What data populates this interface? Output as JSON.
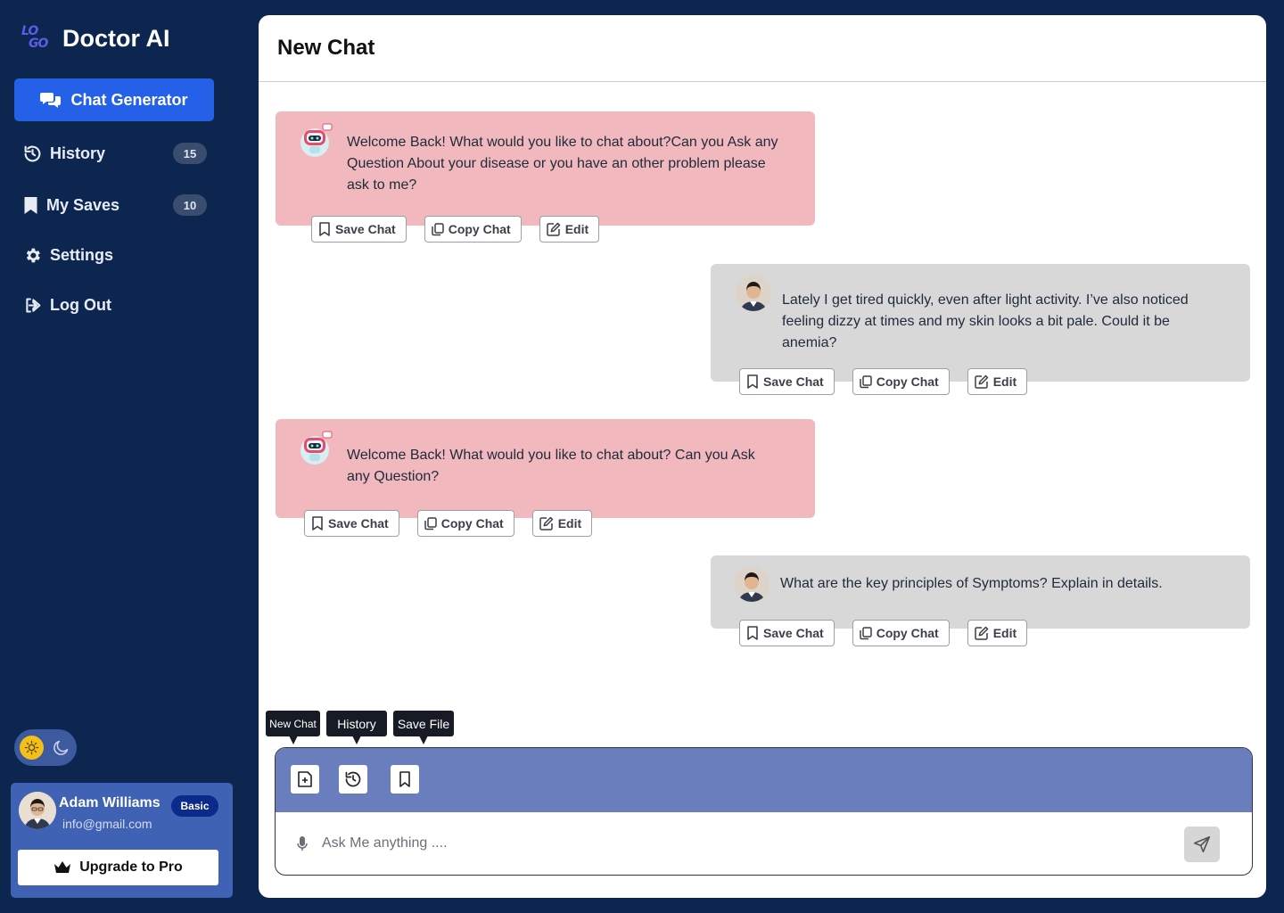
{
  "app": {
    "logo_line1": "LO",
    "logo_line2": "GO",
    "title": "Doctor AI"
  },
  "sidebar": {
    "primary": {
      "label": "Chat Generator",
      "icon": "chat-bubbles-icon"
    },
    "items": [
      {
        "label": "History",
        "icon": "history-icon",
        "count": "15"
      },
      {
        "label": "My Saves",
        "icon": "bookmark-icon",
        "count": "10"
      },
      {
        "label": "Settings",
        "icon": "gear-icon",
        "count": null
      },
      {
        "label": "Log Out",
        "icon": "logout-icon",
        "count": null
      }
    ],
    "theme": {
      "active": "light",
      "icons": [
        "sun-icon",
        "moon-icon"
      ]
    }
  },
  "profile": {
    "name": "Adam Williams",
    "email": "info@gmail.com",
    "plan": "Basic",
    "upgrade_label": "Upgrade to Pro"
  },
  "chat": {
    "title": "New Chat",
    "messages": [
      {
        "role": "bot",
        "text": "Welcome Back! What would you like to chat about?Can you Ask any Question About your disease or you have an other problem please ask to me?"
      },
      {
        "role": "user",
        "text": "Lately I get tired quickly, even after light activity. I’ve also noticed feeling dizzy at times and my skin looks a bit pale. Could it be anemia?"
      },
      {
        "role": "bot",
        "text": "Welcome Back! What would you like to chat about? Can you Ask any Question?"
      },
      {
        "role": "user",
        "text": "What are the key principles of Symptoms? Explain in details."
      }
    ],
    "actions": {
      "save": "Save Chat",
      "copy": "Copy Chat",
      "edit": "Edit"
    }
  },
  "composer": {
    "tooltips": {
      "new_chat": "New Chat",
      "history": "History",
      "save_file": "Save File"
    },
    "placeholder": "Ask Me anything ....",
    "colors": {
      "toolbar": "#6a7dbd"
    }
  },
  "colors": {
    "background": "#0d2650",
    "accent": "#2561e8",
    "bot_bubble": "#f1b8be",
    "user_bubble": "#d8d8d8"
  }
}
